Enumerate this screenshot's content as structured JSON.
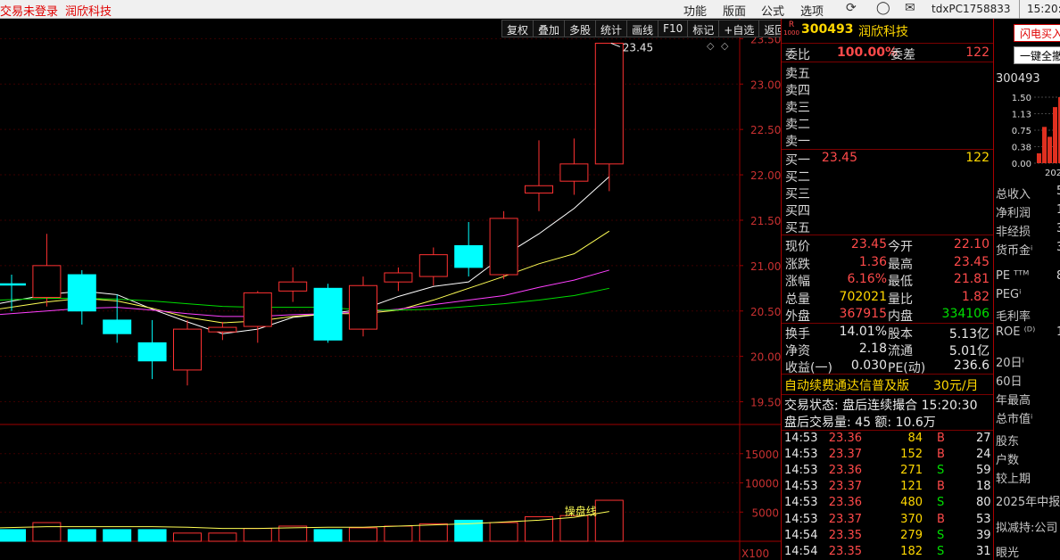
{
  "topbar": {
    "login_status": "交易未登录",
    "stock_name": "润欣科技",
    "menus": [
      "功能",
      "版面",
      "公式",
      "选项"
    ],
    "user_id": "tdxPC1758833",
    "clock": "15:20:5"
  },
  "toolbar": [
    "复权",
    "叠加",
    "多股",
    "统计",
    "画线",
    "F10",
    "标记",
    "+自选",
    "返回"
  ],
  "chart_data": [
    {
      "type": "candlestick",
      "title": "",
      "ylim": [
        19.25,
        23.7
      ],
      "y_ticks": [
        "23.50",
        "23.00",
        "22.50",
        "22.00",
        "21.50",
        "21.00",
        "20.50",
        "20.00",
        "19.50"
      ],
      "high_marker": "23.45",
      "candles": [
        {
          "o": 20.8,
          "h": 20.9,
          "l": 20.5,
          "c": 20.8,
          "dir": "down"
        },
        {
          "o": 20.65,
          "h": 21.35,
          "l": 20.55,
          "c": 21.0,
          "dir": "up"
        },
        {
          "o": 20.9,
          "h": 20.95,
          "l": 20.35,
          "c": 20.5,
          "dir": "down"
        },
        {
          "o": 20.4,
          "h": 20.68,
          "l": 20.15,
          "c": 20.25,
          "dir": "down"
        },
        {
          "o": 20.15,
          "h": 20.4,
          "l": 19.75,
          "c": 19.95,
          "dir": "down"
        },
        {
          "o": 19.85,
          "h": 20.4,
          "l": 19.68,
          "c": 20.3,
          "dir": "up"
        },
        {
          "o": 20.27,
          "h": 20.38,
          "l": 20.18,
          "c": 20.32,
          "dir": "up"
        },
        {
          "o": 20.33,
          "h": 20.72,
          "l": 20.15,
          "c": 20.7,
          "dir": "up"
        },
        {
          "o": 20.72,
          "h": 20.98,
          "l": 20.6,
          "c": 20.82,
          "dir": "up"
        },
        {
          "o": 20.75,
          "h": 20.8,
          "l": 20.15,
          "c": 20.18,
          "dir": "down"
        },
        {
          "o": 20.3,
          "h": 20.88,
          "l": 20.22,
          "c": 20.78,
          "dir": "up"
        },
        {
          "o": 20.82,
          "h": 20.98,
          "l": 20.72,
          "c": 20.92,
          "dir": "up"
        },
        {
          "o": 20.88,
          "h": 21.2,
          "l": 20.78,
          "c": 21.12,
          "dir": "up"
        },
        {
          "o": 21.22,
          "h": 21.48,
          "l": 20.88,
          "c": 20.98,
          "dir": "down"
        },
        {
          "o": 20.9,
          "h": 21.6,
          "l": 20.85,
          "c": 21.52,
          "dir": "up"
        },
        {
          "o": 21.8,
          "h": 22.38,
          "l": 21.6,
          "c": 21.88,
          "dir": "up"
        },
        {
          "o": 21.93,
          "h": 22.4,
          "l": 21.78,
          "c": 22.12,
          "dir": "up"
        },
        {
          "o": 22.12,
          "h": 23.45,
          "l": 21.82,
          "c": 23.45,
          "dir": "up"
        }
      ],
      "ma_lines": [
        {
          "color": "#ffffff",
          "values": [
            20.58,
            20.68,
            20.72,
            20.68,
            20.52,
            20.38,
            20.25,
            20.3,
            20.43,
            20.47,
            20.52,
            20.66,
            20.77,
            20.82,
            21.11,
            21.35,
            21.63,
            21.98
          ]
        },
        {
          "color": "#ffff55",
          "values": [
            20.52,
            20.6,
            20.64,
            20.61,
            20.53,
            20.43,
            20.37,
            20.39,
            20.44,
            20.47,
            20.47,
            20.51,
            20.62,
            20.75,
            20.88,
            21.02,
            21.13,
            21.38
          ]
        },
        {
          "color": "#ff40ff",
          "values": [
            20.46,
            20.5,
            20.53,
            20.54,
            20.51,
            20.47,
            20.44,
            20.44,
            20.46,
            20.47,
            20.49,
            20.52,
            20.57,
            20.62,
            20.67,
            20.76,
            20.84,
            20.95
          ]
        },
        {
          "color": "#00dd00",
          "values": [
            20.62,
            20.64,
            20.64,
            20.63,
            20.61,
            20.58,
            20.55,
            20.54,
            20.54,
            20.54,
            20.51,
            20.51,
            20.52,
            20.55,
            20.58,
            20.62,
            20.67,
            20.75
          ]
        }
      ]
    },
    {
      "type": "bar",
      "title": "",
      "ylim": [
        0,
        20000
      ],
      "y_ticks": [
        "15000",
        "10000",
        "5000"
      ],
      "multiplier": "X100",
      "volume_line_label": "操盘线",
      "values": [
        2000,
        3200,
        2000,
        2000,
        2000,
        1400,
        1400,
        2200,
        2600,
        2000,
        2300,
        2600,
        3000,
        3600,
        3200,
        4200,
        4400,
        7020
      ],
      "volume_line": [
        2300,
        2500,
        2500,
        2500,
        2500,
        2400,
        2200,
        2200,
        2300,
        2400,
        2400,
        2600,
        2800,
        3000,
        3300,
        3600,
        4100,
        5100
      ]
    }
  ],
  "quote": {
    "badge_r": "R",
    "badge_num": "1000",
    "code": "300493",
    "name": "润欣科技",
    "weibi_label": "委比",
    "weibi": "100.00%",
    "weicha_label": "委差",
    "weicha": "122",
    "asks": [
      "卖五",
      "卖四",
      "卖三",
      "卖二",
      "卖一"
    ],
    "bids": [
      {
        "label": "买一",
        "price": "23.45",
        "vol": "122"
      },
      {
        "label": "买二",
        "price": "",
        "vol": ""
      },
      {
        "label": "买三",
        "price": "",
        "vol": ""
      },
      {
        "label": "买四",
        "price": "",
        "vol": ""
      },
      {
        "label": "买五",
        "price": "",
        "vol": ""
      }
    ],
    "stats": [
      {
        "l1": "现价",
        "v1": "23.45",
        "c1": "red",
        "l2": "今开",
        "v2": "22.10",
        "c2": "red"
      },
      {
        "l1": "涨跌",
        "v1": "1.36",
        "c1": "red",
        "l2": "最高",
        "v2": "23.45",
        "c2": "red"
      },
      {
        "l1": "涨幅",
        "v1": "6.16%",
        "c1": "red",
        "l2": "最低",
        "v2": "21.81",
        "c2": "red"
      },
      {
        "l1": "总量",
        "v1": "702021",
        "c1": "yel",
        "l2": "量比",
        "v2": "1.82",
        "c2": "red"
      },
      {
        "l1": "外盘",
        "v1": "367915",
        "c1": "red",
        "l2": "内盘",
        "v2": "334106",
        "c2": "grn"
      }
    ],
    "stats2": [
      {
        "l1": "换手",
        "v1": "14.01%",
        "l2": "股本",
        "v2": "5.13亿"
      },
      {
        "l1": "净资",
        "v1": "2.18",
        "l2": "流通",
        "v2": "5.01亿"
      },
      {
        "l1": "收益(一)",
        "v1": "0.030",
        "l2": "PE(动)",
        "v2": "236.6"
      }
    ],
    "ad_text": "自动续费通达信普及版",
    "ad_price": "30元/月",
    "trade_status": "交易状态: 盘后连续撮合 15:20:30",
    "after_hours": "盘后交易量: 45  额: 10.6万",
    "ticks": [
      {
        "t": "14:53",
        "p": "23.36",
        "v": "84",
        "bs": "B",
        "n": "27"
      },
      {
        "t": "14:53",
        "p": "23.37",
        "v": "152",
        "bs": "B",
        "n": "24"
      },
      {
        "t": "14:53",
        "p": "23.36",
        "v": "271",
        "bs": "S",
        "n": "59"
      },
      {
        "t": "14:53",
        "p": "23.37",
        "v": "121",
        "bs": "B",
        "n": "18"
      },
      {
        "t": "14:53",
        "p": "23.36",
        "v": "480",
        "bs": "S",
        "n": "80"
      },
      {
        "t": "14:53",
        "p": "23.37",
        "v": "370",
        "bs": "B",
        "n": "53"
      },
      {
        "t": "14:54",
        "p": "23.35",
        "v": "279",
        "bs": "S",
        "n": "39"
      },
      {
        "t": "14:54",
        "p": "23.35",
        "v": "182",
        "bs": "S",
        "n": "31"
      }
    ]
  },
  "right_panel": {
    "btn_flash": "闪电买入",
    "btn_clear": "一键全撤",
    "code": "300493",
    "mini_ticks": [
      "1.50",
      "1.13",
      "0.75",
      "0.38",
      "0.00"
    ],
    "mini_year": "202",
    "mini_bars": [
      0.15,
      0.55,
      0.4,
      0.85,
      1.0
    ],
    "fin_rows": [
      {
        "l": "总收入",
        "v": "5"
      },
      {
        "l": "净利润",
        "v": "12"
      },
      {
        "l": "非经损",
        "v": "32"
      },
      {
        "l": "货币金ⁱ",
        "v": "3"
      }
    ],
    "ratio_rows": [
      {
        "l": "PE ᵀᵀᴹ",
        "v": "8"
      },
      {
        "l": "PEGⁱ",
        "v": ""
      },
      {
        "l": "毛利率",
        "v": ""
      },
      {
        "l": "ROE ⁽ᴰ⁾",
        "v": "1"
      }
    ],
    "period_rows": [
      "20日ⁱ",
      "60日",
      "年最高",
      "总市值ⁱ"
    ],
    "holder_rows": [
      "股东",
      "户数",
      "较上期"
    ],
    "report": "2025年中报",
    "reduce": "拟减持:公司",
    "eye": "眼光"
  }
}
